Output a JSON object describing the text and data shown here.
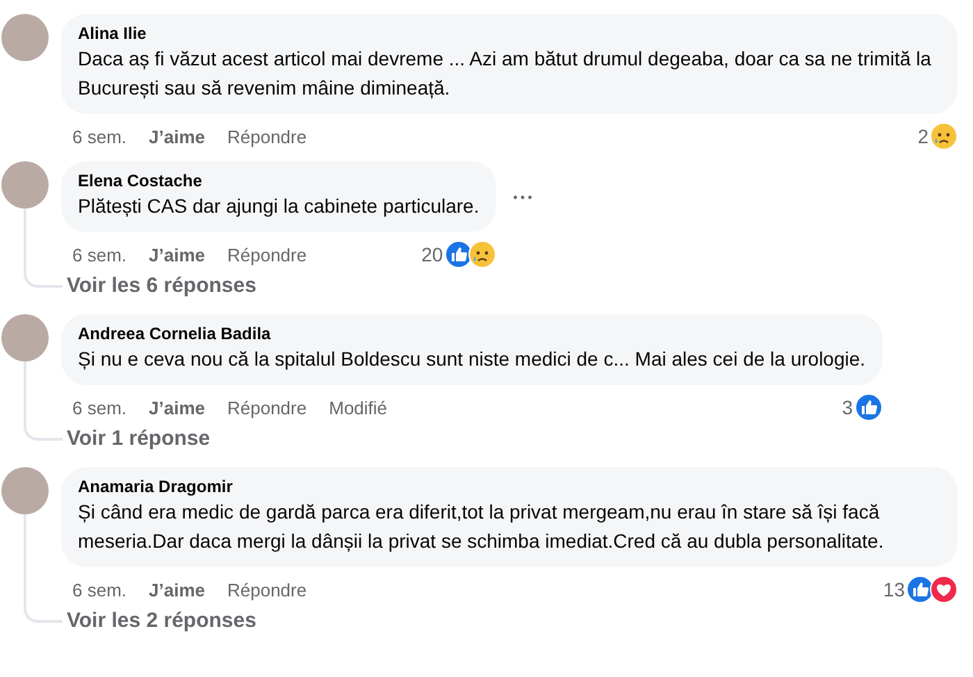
{
  "comments": [
    {
      "author": "Alina Ilie",
      "text": "Daca aș fi văzut acest articol mai devreme ... Azi am bătut drumul degeaba, doar ca sa ne trimită la București sau să revenim mâine dimineață.",
      "time": "6 sem.",
      "like": "J’aime",
      "reply": "Répondre",
      "menu_shown": false,
      "reaction_count": "2",
      "reactions": [
        {
          "kind": "sad"
        }
      ]
    },
    {
      "author": "Elena Costache",
      "text": "Plătești CAS dar ajungi la cabinete particulare.",
      "time": "6 sem.",
      "like": "J’aime",
      "reply": "Répondre",
      "menu_shown": true,
      "reaction_count": "20",
      "reactions": [
        {
          "kind": "like"
        },
        {
          "kind": "sad"
        }
      ],
      "replies_link": "Voir les 6 réponses"
    },
    {
      "author": "Andreea Cornelia Badila",
      "text": "Și nu e ceva nou că la spitalul Boldescu sunt niste medici de c... Mai ales cei de la urologie.",
      "time": "6 sem.",
      "like": "J’aime",
      "reply": "Répondre",
      "edited": "Modifié",
      "menu_shown": false,
      "reaction_count": "3",
      "reactions": [
        {
          "kind": "like"
        }
      ],
      "replies_link": "Voir 1 réponse"
    },
    {
      "author": "Anamaria Dragomir",
      "text": "Și când era medic de gardă parca era diferit,tot la privat mergeam,nu erau în stare să își facă meseria.Dar daca mergi la dânșii la privat se schimba imediat.Cred că au dubla personalitate.",
      "time": "6 sem.",
      "like": "J’aime",
      "reply": "Répondre",
      "menu_shown": false,
      "reaction_count": "13",
      "reactions": [
        {
          "kind": "like"
        },
        {
          "kind": "love"
        }
      ],
      "replies_link": "Voir les 2 réponses"
    }
  ]
}
